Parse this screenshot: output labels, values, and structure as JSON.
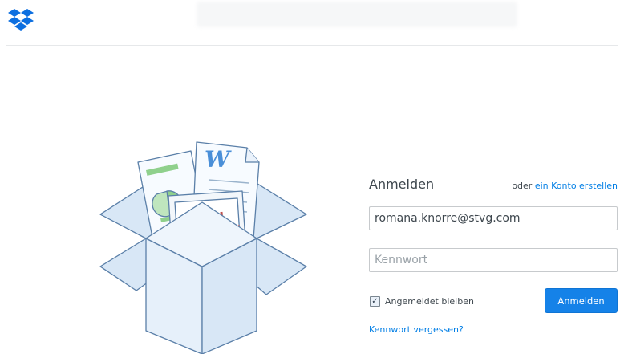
{
  "header": {
    "logo_icon": "dropbox-logo-icon",
    "accent_color": "#007ee5"
  },
  "illustration": {
    "icon": "open-box-with-documents-illustration",
    "doc_letter": "W"
  },
  "login": {
    "title": "Anmelden",
    "alt_prefix": "oder",
    "alt_link": "ein Konto erstellen",
    "email_value": "romana.knorre@stvg.com",
    "password_placeholder": "Kennwort",
    "remember_label": "Angemeldet bleiben",
    "remember_checked": true,
    "submit_label": "Anmelden",
    "forgot_link": "Kennwort vergessen?"
  }
}
